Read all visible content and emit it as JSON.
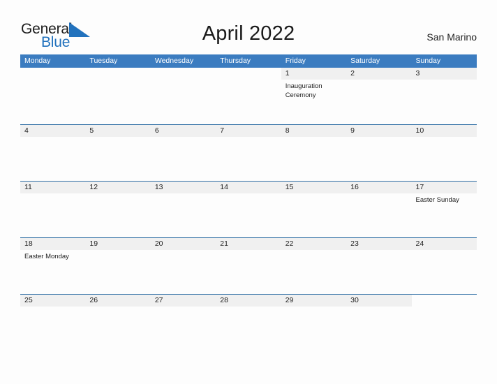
{
  "logo": {
    "word_one": "General",
    "word_two": "Blue",
    "flag_icon": "blue-triangle-flag-icon",
    "colors": {
      "dark": "#1c1c1c",
      "blue": "#2272bd"
    }
  },
  "header": {
    "title": "April 2022",
    "region": "San Marino"
  },
  "theme": {
    "header_blue": "#3b7cc0",
    "row_border_blue": "#2e6da4",
    "day_band_gray": "#f0f0f0",
    "page_background": "#fdfdfd",
    "text": "#1c1c1c"
  },
  "calendar": {
    "weekdays": [
      "Monday",
      "Tuesday",
      "Wednesday",
      "Thursday",
      "Friday",
      "Saturday",
      "Sunday"
    ],
    "weeks": [
      [
        {
          "day": "",
          "blank": true,
          "events": []
        },
        {
          "day": "",
          "blank": true,
          "events": []
        },
        {
          "day": "",
          "blank": true,
          "events": []
        },
        {
          "day": "",
          "blank": true,
          "events": []
        },
        {
          "day": "1",
          "blank": false,
          "events": [
            "Inauguration",
            "Ceremony"
          ]
        },
        {
          "day": "2",
          "blank": false,
          "events": []
        },
        {
          "day": "3",
          "blank": false,
          "events": []
        }
      ],
      [
        {
          "day": "4",
          "blank": false,
          "events": []
        },
        {
          "day": "5",
          "blank": false,
          "events": []
        },
        {
          "day": "6",
          "blank": false,
          "events": []
        },
        {
          "day": "7",
          "blank": false,
          "events": []
        },
        {
          "day": "8",
          "blank": false,
          "events": []
        },
        {
          "day": "9",
          "blank": false,
          "events": []
        },
        {
          "day": "10",
          "blank": false,
          "events": []
        }
      ],
      [
        {
          "day": "11",
          "blank": false,
          "events": []
        },
        {
          "day": "12",
          "blank": false,
          "events": []
        },
        {
          "day": "13",
          "blank": false,
          "events": []
        },
        {
          "day": "14",
          "blank": false,
          "events": []
        },
        {
          "day": "15",
          "blank": false,
          "events": []
        },
        {
          "day": "16",
          "blank": false,
          "events": []
        },
        {
          "day": "17",
          "blank": false,
          "events": [
            "Easter Sunday"
          ]
        }
      ],
      [
        {
          "day": "18",
          "blank": false,
          "events": [
            "Easter Monday"
          ]
        },
        {
          "day": "19",
          "blank": false,
          "events": []
        },
        {
          "day": "20",
          "blank": false,
          "events": []
        },
        {
          "day": "21",
          "blank": false,
          "events": []
        },
        {
          "day": "22",
          "blank": false,
          "events": []
        },
        {
          "day": "23",
          "blank": false,
          "events": []
        },
        {
          "day": "24",
          "blank": false,
          "events": []
        }
      ],
      [
        {
          "day": "25",
          "blank": false,
          "events": []
        },
        {
          "day": "26",
          "blank": false,
          "events": []
        },
        {
          "day": "27",
          "blank": false,
          "events": []
        },
        {
          "day": "28",
          "blank": false,
          "events": []
        },
        {
          "day": "29",
          "blank": false,
          "events": []
        },
        {
          "day": "30",
          "blank": false,
          "events": []
        },
        {
          "day": "",
          "blank": true,
          "events": []
        }
      ]
    ]
  }
}
